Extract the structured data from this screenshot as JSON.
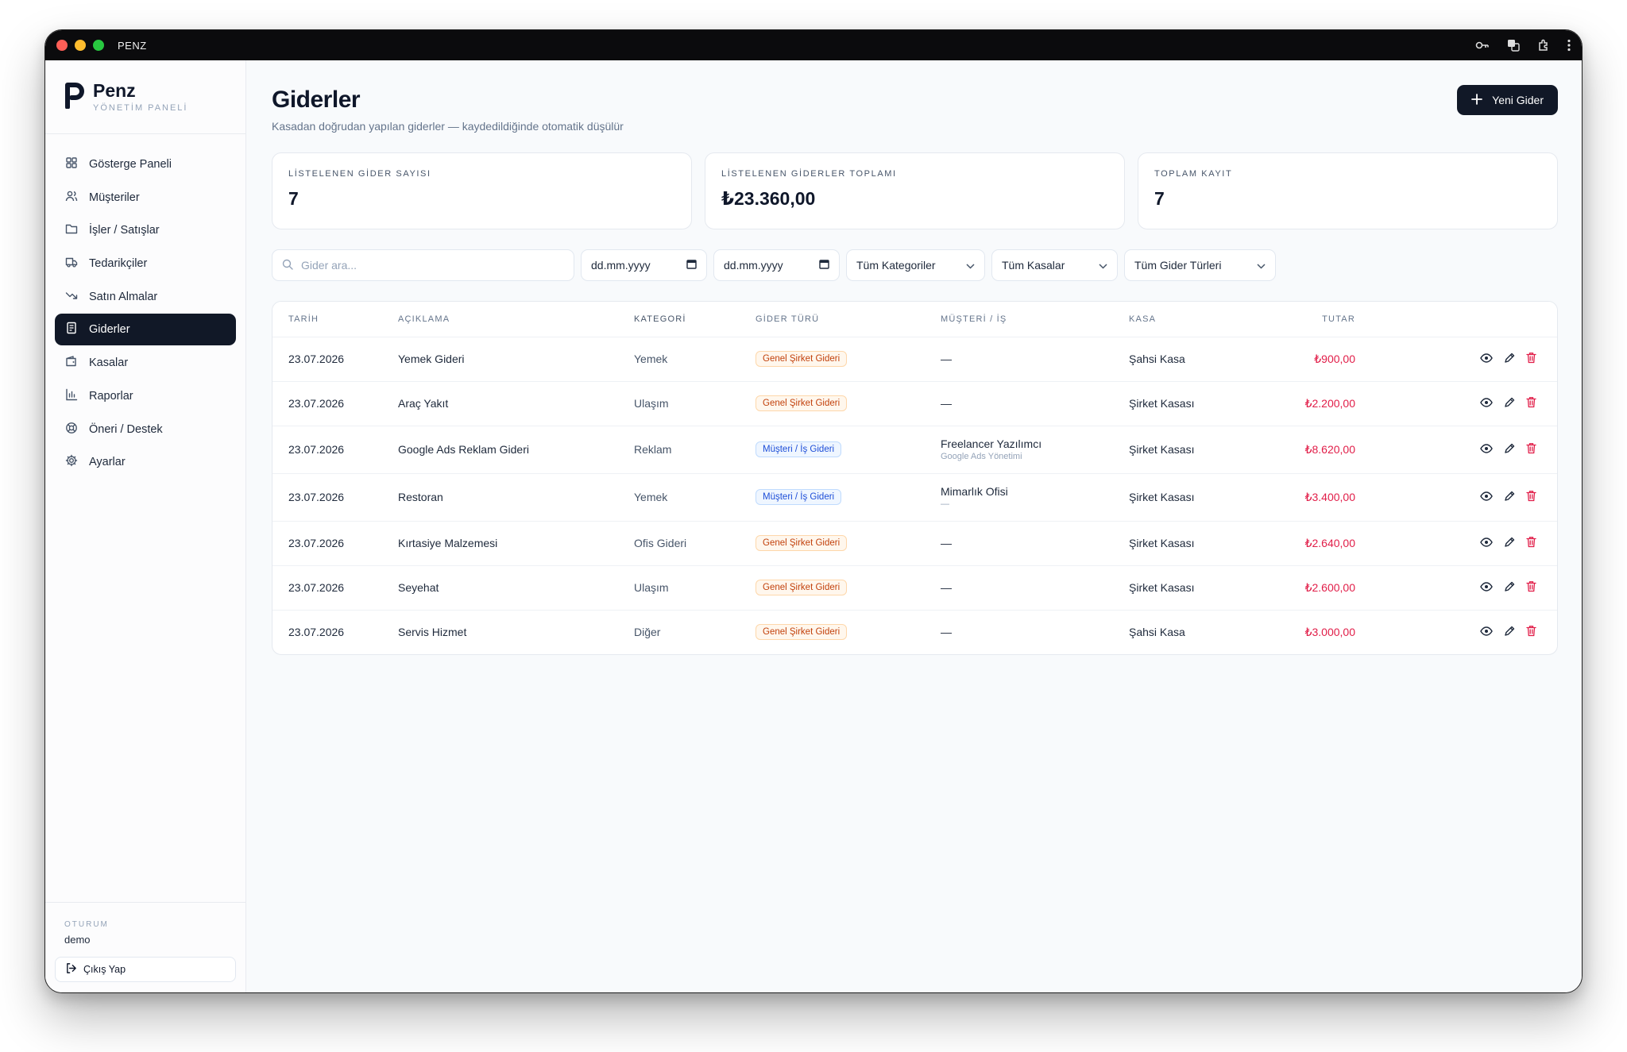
{
  "window": {
    "title": "PENZ"
  },
  "brand": {
    "name": "Penz",
    "subtitle": "YÖNETİM PANELİ"
  },
  "sidebar": {
    "items": [
      {
        "label": "Gösterge Paneli",
        "icon": "dashboard-icon"
      },
      {
        "label": "Müşteriler",
        "icon": "users-icon"
      },
      {
        "label": "İşler / Satışlar",
        "icon": "folder-icon"
      },
      {
        "label": "Tedarikçiler",
        "icon": "truck-icon"
      },
      {
        "label": "Satın Almalar",
        "icon": "trend-down-icon"
      },
      {
        "label": "Giderler",
        "icon": "receipt-icon",
        "active": true
      },
      {
        "label": "Kasalar",
        "icon": "wallet-icon"
      },
      {
        "label": "Raporlar",
        "icon": "bar-chart-icon"
      },
      {
        "label": "Öneri / Destek",
        "icon": "lifebuoy-icon"
      },
      {
        "label": "Ayarlar",
        "icon": "gear-icon"
      }
    ],
    "session_label": "OTURUM",
    "session_user": "demo",
    "logout_label": "Çıkış Yap"
  },
  "header": {
    "title": "Giderler",
    "subtitle": "Kasadan doğrudan yapılan giderler — kaydedildiğinde otomatik düşülür",
    "new_button": "Yeni Gider"
  },
  "stats": [
    {
      "label": "LİSTELENEN GİDER SAYISI",
      "value": "7"
    },
    {
      "label": "LİSTELENEN GİDERLER TOPLAMI",
      "value": "₺23.360,00"
    },
    {
      "label": "TOPLAM KAYIT",
      "value": "7"
    }
  ],
  "filters": {
    "search_placeholder": "Gider ara...",
    "date_from": "dd.mm.yyyy",
    "date_to": "dd.mm.yyyy",
    "category": "Tüm Kategoriler",
    "kasa": "Tüm Kasalar",
    "type": "Tüm Gider Türleri"
  },
  "table": {
    "headers": {
      "date": "TARİH",
      "desc": "AÇIKLAMA",
      "cat": "KATEGORİ",
      "type": "GİDER TÜRÜ",
      "cust": "MÜŞTERİ / İŞ",
      "kasa": "KASA",
      "amount": "TUTAR"
    },
    "rows": [
      {
        "date": "23.07.2026",
        "desc": "Yemek Gideri",
        "cat": "Yemek",
        "type": "Genel Şirket Gideri",
        "type_kind": "general",
        "cust": "—",
        "cust_sub": "",
        "kasa": "Şahsi Kasa",
        "amount": "₺900,00"
      },
      {
        "date": "23.07.2026",
        "desc": "Araç Yakıt",
        "cat": "Ulaşım",
        "type": "Genel Şirket Gideri",
        "type_kind": "general",
        "cust": "—",
        "cust_sub": "",
        "kasa": "Şirket Kasası",
        "amount": "₺2.200,00"
      },
      {
        "date": "23.07.2026",
        "desc": "Google Ads Reklam Gideri",
        "cat": "Reklam",
        "type": "Müşteri / İş Gideri",
        "type_kind": "customer",
        "cust": "Freelancer Yazılımcı",
        "cust_sub": "Google Ads Yönetimi",
        "kasa": "Şirket Kasası",
        "amount": "₺8.620,00"
      },
      {
        "date": "23.07.2026",
        "desc": "Restoran",
        "cat": "Yemek",
        "type": "Müşteri / İş Gideri",
        "type_kind": "customer",
        "cust": "Mimarlık Ofisi",
        "cust_sub": "—",
        "kasa": "Şirket Kasası",
        "amount": "₺3.400,00"
      },
      {
        "date": "23.07.2026",
        "desc": "Kırtasiye Malzemesi",
        "cat": "Ofis Gideri",
        "type": "Genel Şirket Gideri",
        "type_kind": "general",
        "cust": "—",
        "cust_sub": "",
        "kasa": "Şirket Kasası",
        "amount": "₺2.640,00"
      },
      {
        "date": "23.07.2026",
        "desc": "Seyehat",
        "cat": "Ulaşım",
        "type": "Genel Şirket Gideri",
        "type_kind": "general",
        "cust": "—",
        "cust_sub": "",
        "kasa": "Şirket Kasası",
        "amount": "₺2.600,00"
      },
      {
        "date": "23.07.2026",
        "desc": "Servis Hizmet",
        "cat": "Diğer",
        "type": "Genel Şirket Gideri",
        "type_kind": "general",
        "cust": "—",
        "cust_sub": "",
        "kasa": "Şahsi Kasa",
        "amount": "₺3.000,00"
      }
    ]
  },
  "colors": {
    "accent": "#111827",
    "negative": "#e11d48",
    "badge_general": "#c2410c",
    "badge_customer": "#1d4ed8"
  }
}
